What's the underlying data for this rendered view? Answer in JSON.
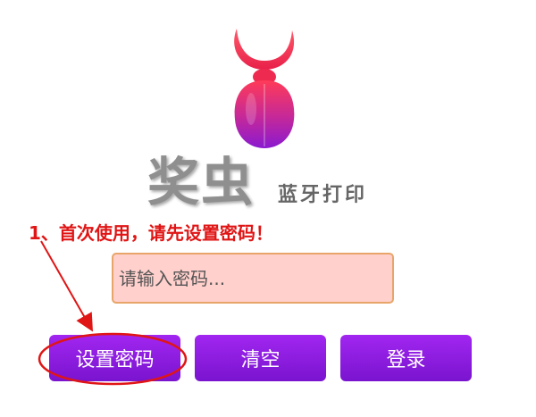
{
  "app": {
    "brand_name": "奖虫",
    "brand_tagline": "蓝牙打印",
    "logo_icon": "beetle-logo-icon"
  },
  "instruction": {
    "text": "1、首次使用，请先设置密码！",
    "color": "#e01515"
  },
  "password_input": {
    "placeholder": "请输入密码...",
    "value": ""
  },
  "buttons": {
    "set_password": "设置密码",
    "clear": "清空",
    "login": "登录"
  },
  "colors": {
    "button_accent": "#8b1ce0",
    "input_background": "#ffd0cc",
    "input_border": "#e8a56a",
    "annotation": "#e01515"
  }
}
